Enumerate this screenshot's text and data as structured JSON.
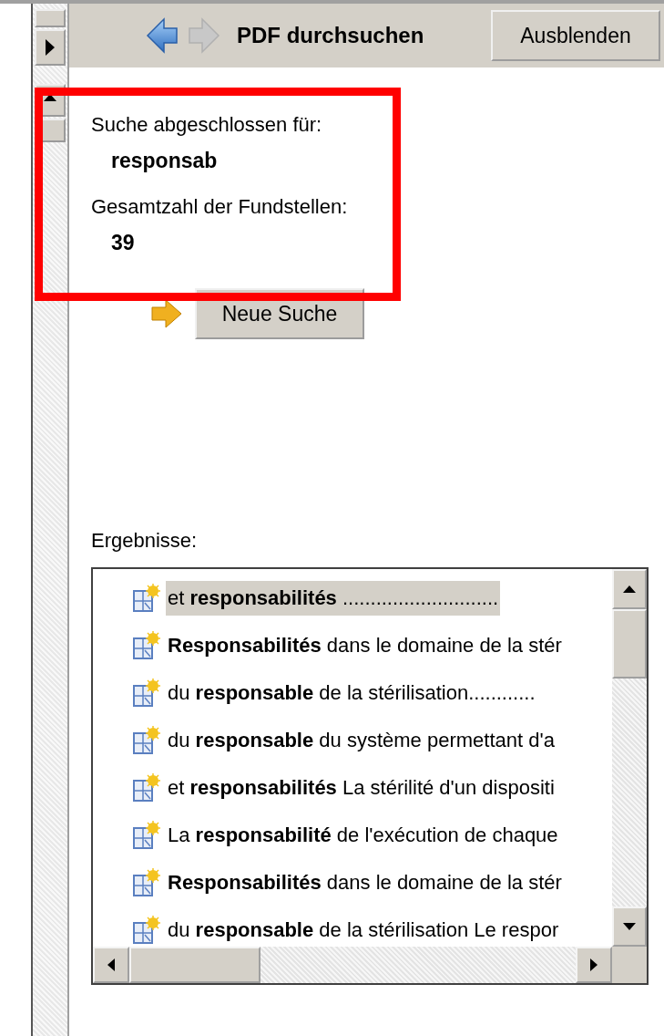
{
  "panel": {
    "title": "PDF durchsuchen",
    "hide_button": "Ausblenden"
  },
  "summary": {
    "label": "Suche abgeschlossen für:",
    "term": "responsab",
    "count_label": "Gesamtzahl der Fundstellen:",
    "count": "39",
    "highlighted": true
  },
  "new_search_button": "Neue Suche",
  "results": {
    "label": "Ergebnisse:",
    "rows": [
      {
        "text": "et **responsabilités** ............................",
        "selected": true
      },
      {
        "text": "**Responsabilités** dans le domaine de la stér",
        "selected": false
      },
      {
        "text": "du **responsable** de la stérilisation............",
        "selected": false
      },
      {
        "text": "du **responsable** du système permettant d'a",
        "selected": false
      },
      {
        "text": "et **responsabilités** La stérilité d'un dispositi",
        "selected": false
      },
      {
        "text": "La **responsabilité** de l'exécution de chaque",
        "selected": false
      },
      {
        "text": "**Responsabilités** dans le domaine de la stér",
        "selected": false
      },
      {
        "text": "du **responsable** de la stérilisation Le respor",
        "selected": false
      }
    ]
  }
}
